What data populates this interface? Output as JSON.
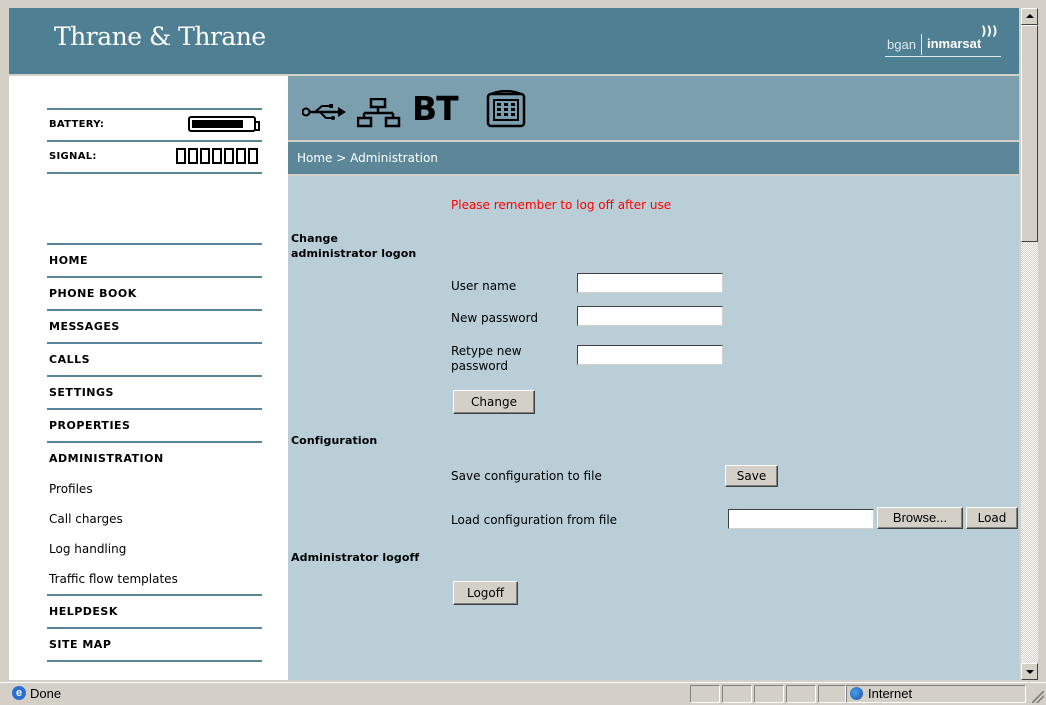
{
  "header": {
    "logo_text": "Thrane & Thrane",
    "partner_logo": {
      "left": "bgan",
      "right": "inmarsat"
    }
  },
  "sidebar": {
    "battery_label": "BATTERY:",
    "battery_level_pct": 85,
    "signal_label": "SIGNAL:",
    "signal_bars_filled": 0,
    "signal_bars_total": 7,
    "nav": [
      {
        "label": "HOME",
        "type": "main"
      },
      {
        "label": "PHONE BOOK",
        "type": "main"
      },
      {
        "label": "MESSAGES",
        "type": "main"
      },
      {
        "label": "CALLS",
        "type": "main"
      },
      {
        "label": "SETTINGS",
        "type": "main"
      },
      {
        "label": "PROPERTIES",
        "type": "main"
      },
      {
        "label": "ADMINISTRATION",
        "type": "main"
      },
      {
        "label": "Profiles",
        "type": "sub"
      },
      {
        "label": "Call charges",
        "type": "sub"
      },
      {
        "label": "Log handling",
        "type": "sub"
      },
      {
        "label": "Traffic flow templates",
        "type": "sub"
      },
      {
        "label": "HELPDESK",
        "type": "main"
      },
      {
        "label": "SITE MAP",
        "type": "main"
      }
    ]
  },
  "icons": {
    "bt_text": "BT",
    "items": [
      "usb-icon",
      "lan-icon",
      "bluetooth-icon",
      "phone-icon"
    ]
  },
  "breadcrumb": "Home > Administration",
  "main": {
    "warning": "Please remember to log off after use",
    "logon": {
      "title_line1": "Change",
      "title_line2": "administrator logon",
      "username_label": "User name",
      "username_value": "",
      "new_password_label": "New password",
      "new_password_value": "",
      "retype_label_line1": "Retype new",
      "retype_label_line2": "password",
      "retype_value": "",
      "change_button": "Change"
    },
    "configuration": {
      "title": "Configuration",
      "save_label": "Save configuration to file",
      "save_button": "Save",
      "load_label": "Load configuration from file",
      "file_value": "",
      "browse_button": "Browse...",
      "load_button": "Load"
    },
    "logoff": {
      "title": "Administrator logoff",
      "logoff_button": "Logoff"
    }
  },
  "statusbar": {
    "status_text": "Done",
    "zone_text": "Internet"
  },
  "colors": {
    "header_bg": "#4f7f93",
    "icon_band_bg": "#7b9fae",
    "breadcrumb_bg": "#5b8799",
    "content_bg": "#b9ced6",
    "warning": "#ff0000"
  }
}
